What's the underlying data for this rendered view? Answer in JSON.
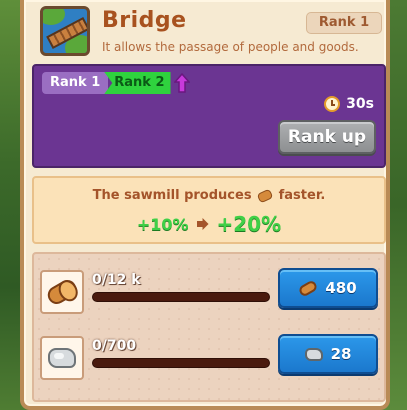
{
  "building": {
    "title": "Bridge",
    "description": "It allows the passage of people and goods.",
    "rank_badge": "Rank 1"
  },
  "rank_panel": {
    "current_rank": "Rank 1",
    "next_rank": "Rank 2",
    "timer": "30s",
    "rank_up_label": "Rank up"
  },
  "info": {
    "text_before": "The sawmill produces",
    "text_after": "faster.",
    "old_bonus": "+10%",
    "new_bonus": "+20%"
  },
  "resources": [
    {
      "name": "wood",
      "count": "0/12 k",
      "progress": 0,
      "cost": "480",
      "icon": "log-icon"
    },
    {
      "name": "stone",
      "count": "0/700",
      "progress": 0,
      "cost": "28",
      "icon": "stone-icon"
    }
  ],
  "colors": {
    "panel_bg": "#f6ead2",
    "title": "#a8521f",
    "rank_box": "#6b3592",
    "next_rank": "#2fd23e",
    "bonus_green": "#40d047",
    "blue_button": "#1b78cd",
    "grey_button": "#8d8f91"
  }
}
